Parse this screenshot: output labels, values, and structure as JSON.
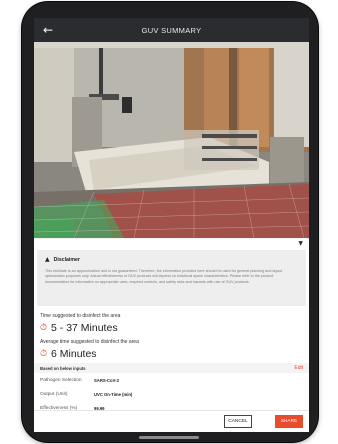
{
  "app": {
    "title": "GUV SUMMARY",
    "back_glyph": "←"
  },
  "photo": {
    "description_icon": "room-camera-view"
  },
  "disclaimer": {
    "title": "Disclaimer",
    "text": "This estimate is an approximation and is not guaranteed. Therefore, the information provided here should be used for general planning and layout optimization purposes only. Actual effectiveness of GUV products will depend on individual space characteristics. Please refer to the product documentation for information on appropriate uses, required controls, and safety risks and hazards with use of GUV products."
  },
  "time_suggested": {
    "label": "Time suggested to disinfect the area",
    "value": "5 - 37 Minutes"
  },
  "average_time": {
    "label": "Average time suggested to disinfect the area",
    "value": "6 Minutes"
  },
  "inputs": {
    "header": "Based on below inputs",
    "edit_label": "Edit",
    "rows": [
      {
        "key": "Pathogen Selection",
        "value": "SARS-CoV-2"
      },
      {
        "key": "Output (Unit)",
        "value": "UVC On-Time (min)"
      },
      {
        "key": "Effectiveness (%)",
        "value": "99.99"
      }
    ]
  },
  "footer": {
    "cancel_label": "CANCEL",
    "share_label": "SHARE"
  },
  "colors": {
    "accent": "#e84c2c",
    "appbar": "#2b2c30"
  }
}
